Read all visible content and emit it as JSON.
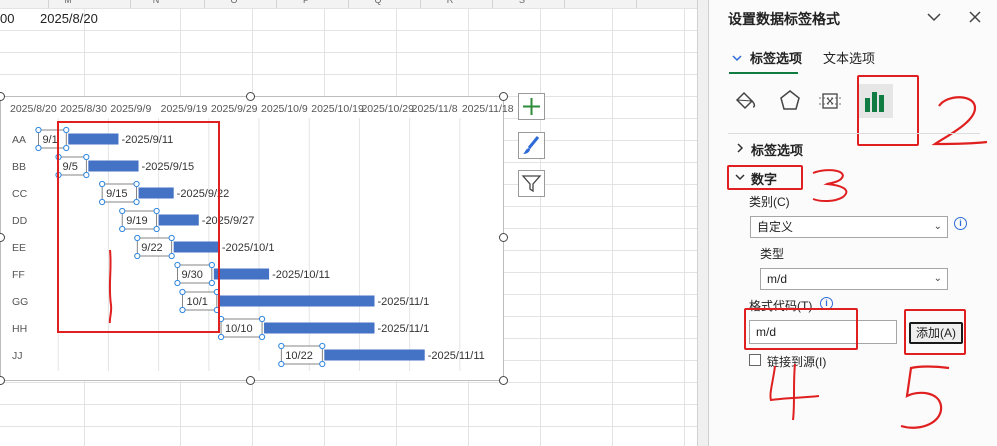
{
  "sheet": {
    "columns": [
      "M",
      "N",
      "O",
      "P",
      "Q",
      "R",
      "S"
    ],
    "cell_a_text": "00",
    "cell_date_text": "2025/8/20"
  },
  "chart_data": {
    "type": "bar",
    "subtype": "gantt",
    "x_tick_labels": [
      "2025/8/20",
      "2025/8/30",
      "2025/9/9",
      "2025/9/19",
      "2025/9/29",
      "2025/10/9",
      "2025/10/19",
      "2025/10/29",
      "2025/11/8",
      "2025/11/18"
    ],
    "categories": [
      "AA",
      "BB",
      "CC",
      "DD",
      "EE",
      "FF",
      "GG",
      "HH",
      "JJ"
    ],
    "start_labels": [
      "9/1",
      "9/5",
      "9/15",
      "9/19",
      "9/22",
      "9/30",
      "10/1",
      "10/10",
      "10/22"
    ],
    "end_labels": [
      "2025/9/11",
      "2025/9/15",
      "2025/9/22",
      "2025/9/27",
      "2025/10/1",
      "2025/10/11",
      "2025/11/1",
      "2025/11/1",
      "2025/11/11"
    ],
    "start_dates": [
      "2025-09-01",
      "2025-09-05",
      "2025-09-15",
      "2025-09-19",
      "2025-09-22",
      "2025-09-30",
      "2025-10-01",
      "2025-10-10",
      "2025-10-22"
    ],
    "end_dates": [
      "2025-09-11",
      "2025-09-15",
      "2025-09-22",
      "2025-09-27",
      "2025-10-01",
      "2025-10-11",
      "2025-11-01",
      "2025-11-01",
      "2025-11-11"
    ],
    "xlim": [
      "2025-08-20",
      "2025-11-25"
    ],
    "bar_color": "#4472c4",
    "grid": true,
    "legend": "none"
  },
  "chart_tools": {
    "icons": [
      "plus-icon",
      "brush-icon",
      "filter-icon"
    ]
  },
  "pane": {
    "title": "设置数据标签格式",
    "tabs": [
      {
        "label": "标签选项",
        "active": true
      },
      {
        "label": "文本选项",
        "active": false
      }
    ],
    "sections": {
      "label_options": "标签选项",
      "number": "数字"
    },
    "category_label": "类别(C)",
    "category_value": "自定义",
    "type_label": "类型",
    "type_value": "m/d",
    "format_code_label": "格式代码(T)",
    "format_code_value": "m/d",
    "add_button": "添加(A)",
    "link_to_source": "链接到源(I)"
  },
  "annotations": [
    "1",
    "2",
    "3",
    "4",
    "5"
  ],
  "colors": {
    "accent": "#107c41",
    "annotation_red": "#e02020",
    "bar": "#4472c4"
  }
}
